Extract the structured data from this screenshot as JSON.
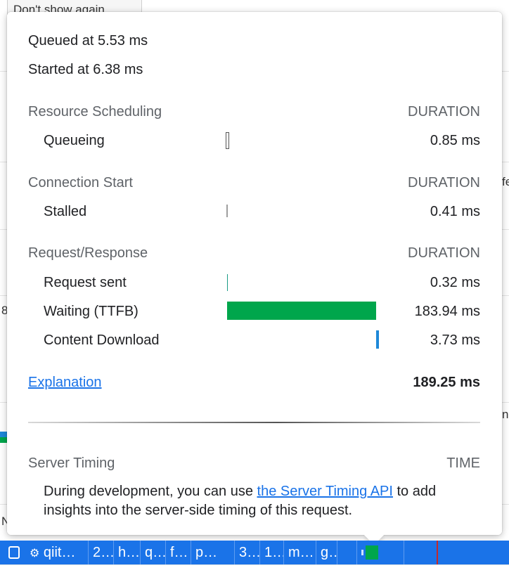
{
  "background": {
    "dont_show_button": "Don't show again",
    "right_fragment_1": "fe",
    "right_fragment_2": "n",
    "left_fragment_1": "8",
    "left_fragment_2": "N"
  },
  "timing": {
    "queued_at": "Queued at 5.53 ms",
    "started_at": "Started at 6.38 ms",
    "duration_header": "DURATION",
    "sections": [
      {
        "title": "Resource Scheduling",
        "rows": [
          {
            "label": "Queueing",
            "value": "0.85 ms",
            "color": "#ffffff",
            "border": "#555555"
          }
        ]
      },
      {
        "title": "Connection Start",
        "rows": [
          {
            "label": "Stalled",
            "value": "0.41 ms",
            "color": "#9e9e9e"
          }
        ]
      },
      {
        "title": "Request/Response",
        "rows": [
          {
            "label": "Request sent",
            "value": "0.32 ms",
            "color": "#1a9b86"
          },
          {
            "label": "Waiting (TTFB)",
            "value": "183.94 ms",
            "color": "#00a64c"
          },
          {
            "label": "Content Download",
            "value": "3.73 ms",
            "color": "#1e88d8"
          }
        ]
      }
    ],
    "explanation_link": "Explanation",
    "total": "189.25 ms"
  },
  "server_timing": {
    "title": "Server Timing",
    "time_header": "TIME",
    "desc_before": "During development, you can use ",
    "desc_link": "the Server Timing API",
    "desc_after": " to add insights into the server-side timing of this request."
  },
  "selected_row": {
    "cells": [
      "qiit…",
      "2…",
      "h…",
      "q…",
      "f…",
      "p…",
      "3…",
      "1…",
      "m…",
      "g…"
    ],
    "gear_icon": "gear-icon",
    "row_color": "#1a73e8",
    "waterfall_color": "#00a64c"
  }
}
